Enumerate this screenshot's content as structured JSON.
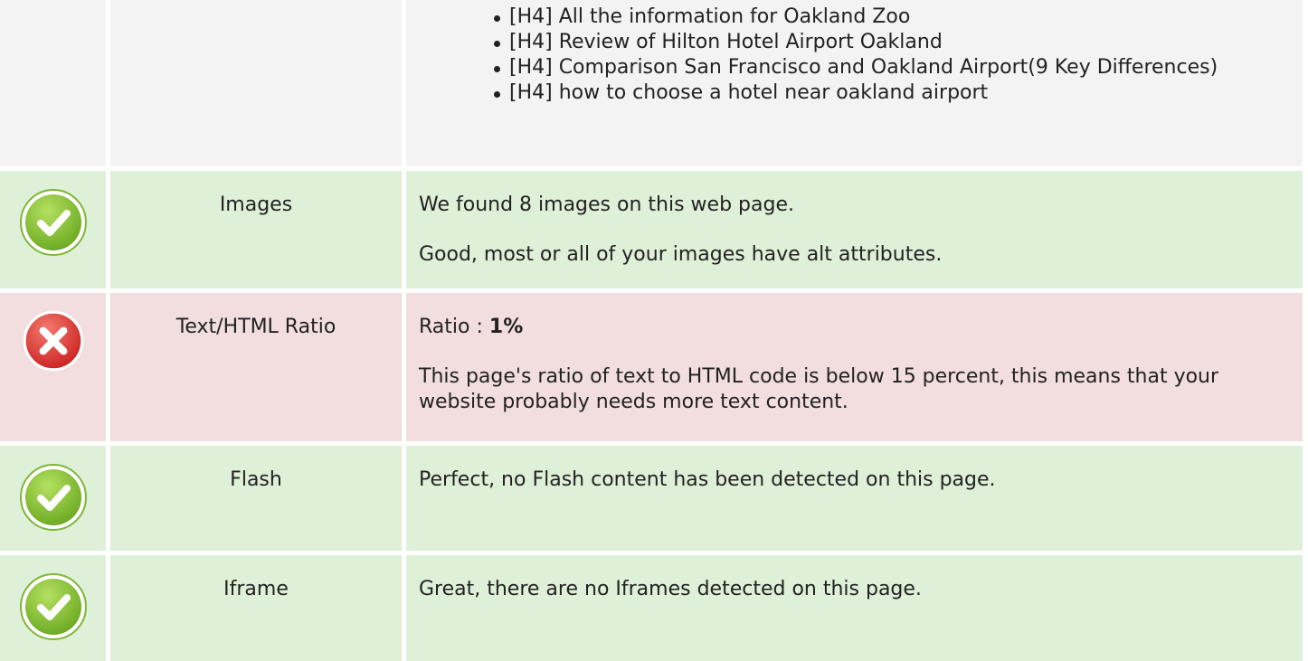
{
  "heading_list": {
    "items": [
      "[H4] All the information for Oakland Zoo",
      "[H4] Review of Hilton Hotel Airport Oakland",
      "[H4] Comparison San Francisco and Oakland Airport(9 Key Differences)",
      "[H4] how to choose a hotel near oakland airport"
    ]
  },
  "rows": {
    "images": {
      "status": "pass",
      "title": "Images",
      "line1": "We found 8 images on this web page.",
      "line2": "Good, most or all of your images have alt attributes."
    },
    "ratio": {
      "status": "fail",
      "title": "Text/HTML Ratio",
      "label": "Ratio : ",
      "value": "1%",
      "line2": "This page's ratio of text to HTML code is below 15 percent, this means that your website probably needs more text content."
    },
    "flash": {
      "status": "pass",
      "title": "Flash",
      "line1": "Perfect, no Flash content has been detected on this page."
    },
    "iframe": {
      "status": "pass",
      "title": "Iframe",
      "line1": "Great, there are no Iframes detected on this page."
    }
  },
  "colors": {
    "pass_bg": "#dff0d8",
    "fail_bg": "#f2dede",
    "neutral_bg": "#f3f3f3",
    "pass_icon": "#8cc63f",
    "fail_icon": "#e03a3a"
  },
  "icons": {
    "pass": "check-circle-icon",
    "fail": "x-circle-icon"
  }
}
